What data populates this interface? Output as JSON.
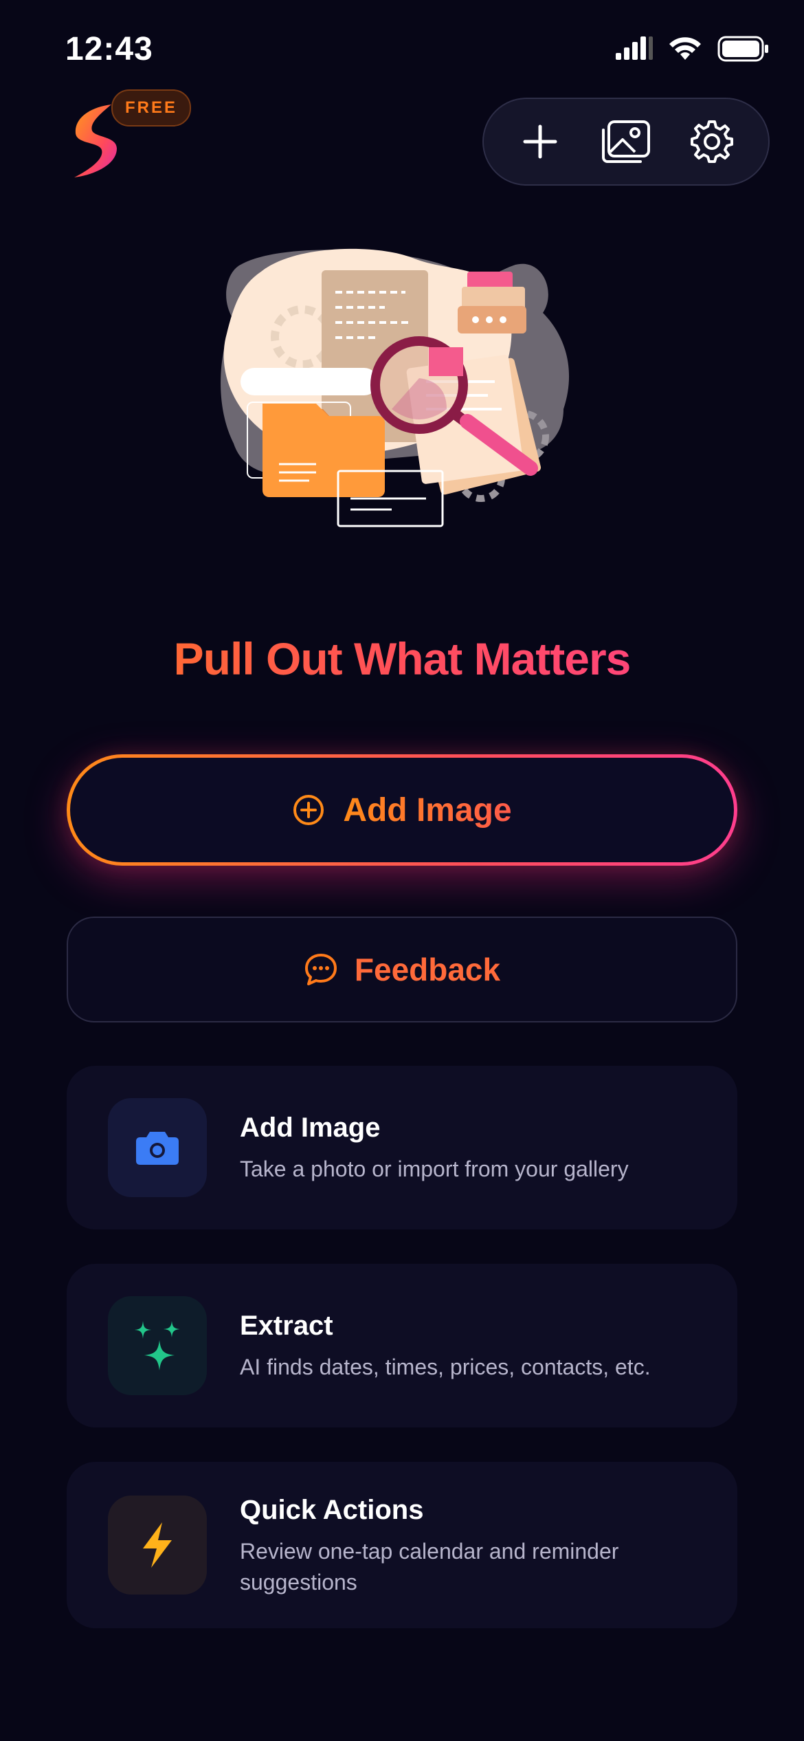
{
  "status_bar": {
    "time": "12:43"
  },
  "header": {
    "badge": "FREE"
  },
  "toolbar": {
    "buttons": [
      "plus-icon",
      "gallery-icon",
      "gear-icon"
    ]
  },
  "hero": {
    "headline": "Pull Out What Matters"
  },
  "actions": {
    "primary_label": "Add Image",
    "feedback_label": "Feedback"
  },
  "features": [
    {
      "title": "Add Image",
      "description": "Take a photo or import from your gallery",
      "icon": "camera-icon",
      "color": "#3b7cf5"
    },
    {
      "title": "Extract",
      "description": "AI finds dates, times, prices, contacts, etc.",
      "icon": "sparkles-icon",
      "color": "#22c68a"
    },
    {
      "title": "Quick Actions",
      "description": "Review one-tap calendar and reminder suggestions",
      "icon": "bolt-icon",
      "color": "#ffb21a"
    }
  ],
  "colors": {
    "background": "#070617",
    "accent_orange": "#ff7a1a",
    "accent_pink": "#ff3e8e"
  }
}
